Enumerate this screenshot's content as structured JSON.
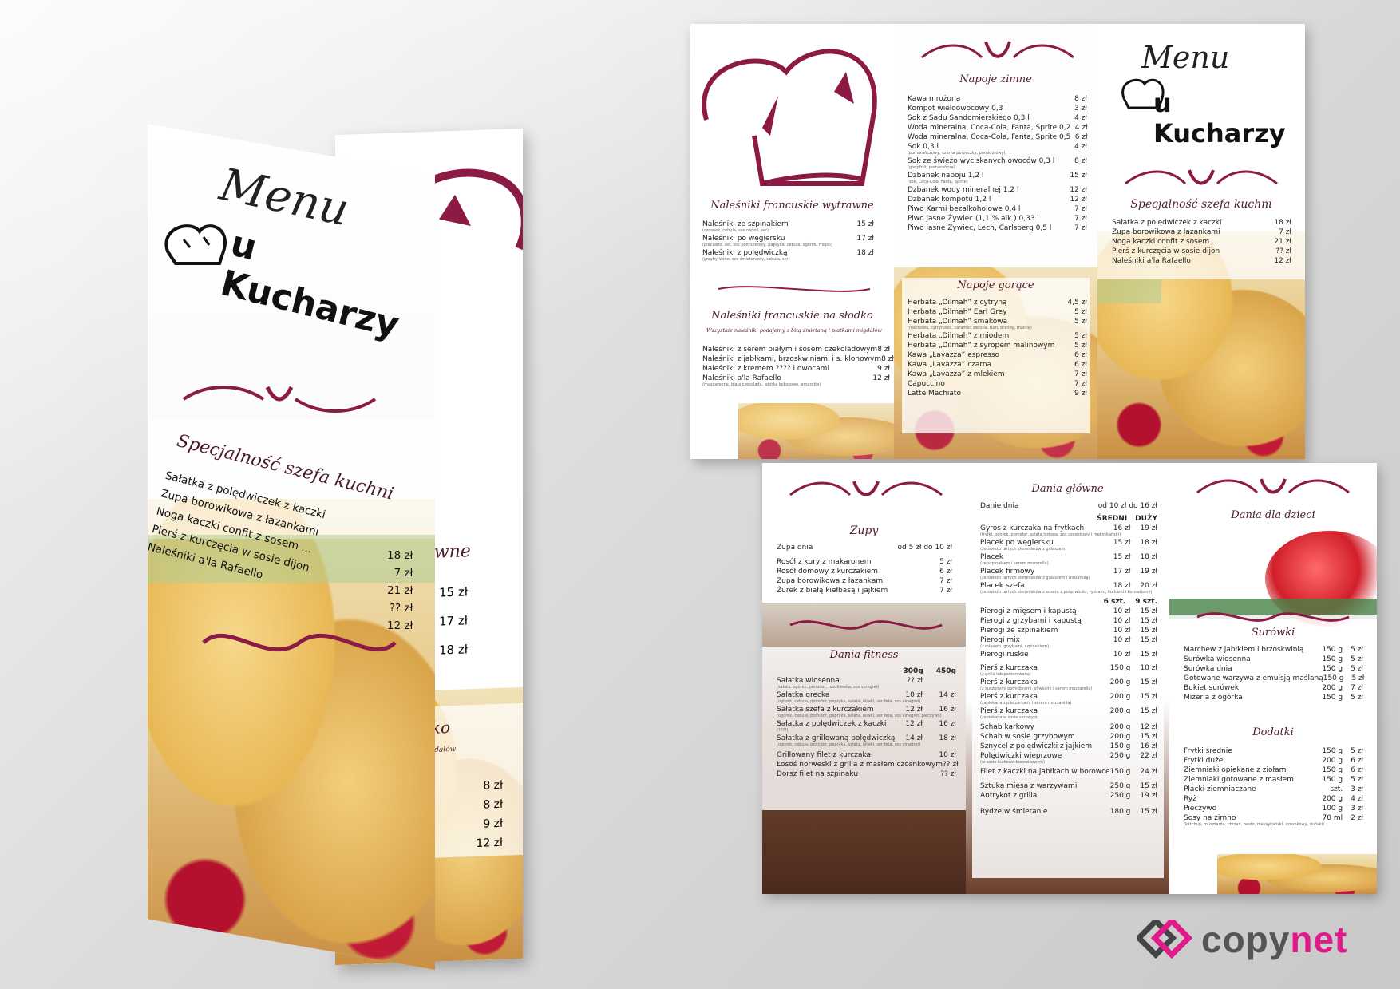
{
  "brand": {
    "menu_word": "Menu",
    "restaurant_name": "u Kucharzy",
    "maroon": "#8b1a45",
    "copynet": {
      "part1": "copy",
      "part2": "net",
      "accent": "#e01a8a"
    }
  },
  "specialties": {
    "title": "Specjalność szefa kuchni",
    "items": [
      {
        "name": "Sałatka z polędwiczek z kaczki",
        "price": "18 zł"
      },
      {
        "name": "Zupa borowikowa z łazankami",
        "price": "7 zł"
      },
      {
        "name": "Noga kaczki confit z sosem ...",
        "price": "21 zł"
      },
      {
        "name": "Pierś z kurczęcia w sosie dijon",
        "price": "?? zł"
      },
      {
        "name": "Naleśniki a'la Rafaello",
        "price": "12 zł"
      }
    ]
  },
  "savory": {
    "title": "Naleśniki francuskie wytrawne",
    "items": [
      {
        "name": "Naleśniki ze szpinakiem",
        "desc": "(czosnek, cebula, sos napoli, ser)",
        "price": "15 zł"
      },
      {
        "name": "Naleśniki po węgiersku",
        "desc": "(pieczarki, ser, sos pomidorowy, papryka, cebula, ogórek, mięso)",
        "price": "17 zł"
      },
      {
        "name": "Naleśniki z polędwiczką",
        "desc": "(grzyby leśne, sos śmietanowy, cebula, ser)",
        "price": "18 zł"
      }
    ]
  },
  "sweet": {
    "title": "Naleśniki francuskie na słodko",
    "note": "Wszystkie naleśniki podajemy z bitą śmietaną i płatkami migdałów",
    "items": [
      {
        "name": "Naleśniki z serem białym i sosem czekoladowym",
        "desc": "",
        "price": "8 zł"
      },
      {
        "name": "Naleśniki z jabłkami, brzoskwiniami i s. klonowym",
        "desc": "",
        "price": "8 zł"
      },
      {
        "name": "Naleśniki z kremem ???? i owocami",
        "desc": "",
        "price": "9 zł"
      },
      {
        "name": "Naleśniki a'la Rafaello",
        "desc": "(mascarpone, biała czekolada, wiórka kokosowe, amaretto)",
        "price": "12 zł"
      }
    ]
  },
  "cold_drinks": {
    "title": "Napoje zimne",
    "items": [
      {
        "name": "Kawa mrożona",
        "desc": "",
        "price": "8 zł"
      },
      {
        "name": "Kompot wieloowocowy 0,3 l",
        "desc": "",
        "price": "3 zł"
      },
      {
        "name": "Sok z Sadu Sandomierskiego 0,3 l",
        "desc": "",
        "price": "4 zł"
      },
      {
        "name": "Woda mineralna, Coca-Cola, Fanta, Sprite 0,2 l",
        "desc": "",
        "price": "4 zł"
      },
      {
        "name": "Woda mineralna, Coca-Cola, Fanta, Sprite 0,5 l",
        "desc": "",
        "price": "6 zł"
      },
      {
        "name": "Sok 0,3 l",
        "desc": "(pomarańczowy, czarna porzeczka, pomidorowy)",
        "price": "4 zł"
      },
      {
        "name": "Sok ze świeżo wyciskanych owoców 0,3 l",
        "desc": "(grejpfrut, pomarańcza)",
        "price": "8 zł"
      },
      {
        "name": "Dzbanek napoju 1,2 l",
        "desc": "(sok, Coca-Cola, Fanta, Sprite)",
        "price": "15 zł"
      },
      {
        "name": "Dzbanek wody mineralnej 1,2 l",
        "desc": "",
        "price": "12 zł"
      },
      {
        "name": "Dzbanek kompotu 1,2 l",
        "desc": "",
        "price": "12 zł"
      },
      {
        "name": "Piwo Karmi bezalkoholowe 0,4 l",
        "desc": "",
        "price": "7 zł"
      },
      {
        "name": "Piwo jasne Żywiec (1,1 % alk.) 0,33 l",
        "desc": "",
        "price": "7 zł"
      },
      {
        "name": "Piwo jasne Żywiec, Lech, Carlsberg 0,5 l",
        "desc": "",
        "price": "7 zł"
      }
    ]
  },
  "hot_drinks": {
    "title": "Napoje gorące",
    "items": [
      {
        "name": "Herbata „Dilmah” z cytryną",
        "desc": "",
        "price": "4,5 zł"
      },
      {
        "name": "Herbata „Dilmah” Earl Grey",
        "desc": "",
        "price": "5 zł"
      },
      {
        "name": "Herbata „Dilmah” smakowa",
        "desc": "(malinowa, cytrynowa, caramel, zielona, rum, brandy, malina)",
        "price": "5 zł"
      },
      {
        "name": "Herbata „Dilmah” z miodem",
        "desc": "",
        "price": "5 zł"
      },
      {
        "name": "Herbata „Dilmah” z syropem malinowym",
        "desc": "",
        "price": "5 zł"
      },
      {
        "name": "Kawa „Lavazza” espresso",
        "desc": "",
        "price": "6 zł"
      },
      {
        "name": "Kawa „Lavazza” czarna",
        "desc": "",
        "price": "6 zł"
      },
      {
        "name": "Kawa „Lavazza” z mlekiem",
        "desc": "",
        "price": "7 zł"
      },
      {
        "name": "Capuccino",
        "desc": "",
        "price": "7 zł"
      },
      {
        "name": "Latte Machiato",
        "desc": "",
        "price": "9 zł"
      }
    ]
  },
  "soups": {
    "title": "Zupy",
    "daily": {
      "name": "Zupa dnia",
      "price": "od 5 zł do 10 zł"
    },
    "items": [
      {
        "name": "Rosół z kury z makaronem",
        "price": "5 zł"
      },
      {
        "name": "Rosół domowy z kurczakiem",
        "price": "6 zł"
      },
      {
        "name": "Zupa borowikowa z łazankami",
        "price": "7 zł"
      },
      {
        "name": "Żurek z białą kiełbasą i jajkiem",
        "price": "7 zł"
      }
    ]
  },
  "fitness": {
    "title": "Dania fitness",
    "col1": "300g",
    "col2": "450g",
    "items": [
      {
        "name": "Sałatka wiosenna",
        "desc": "(sałata, ogórek, pomidor, rzodkiewka, sos vinegret)",
        "p1": "?? zł",
        "p2": ""
      },
      {
        "name": "Sałatka grecka",
        "desc": "(ogórek, cebula, pomidor, papryka, sałata, oliwki, ser feta, sos vinegret)",
        "p1": "10 zł",
        "p2": "14 zł"
      },
      {
        "name": "Sałatka szefa z kurczakiem",
        "desc": "(ogórek, cebula, pomidor, papryka, sałata, oliwki, ser feta, sos vinegret, pieczywo)",
        "p1": "12 zł",
        "p2": "16 zł"
      },
      {
        "name": "Sałatka z polędwiczek z kaczki",
        "desc": "(????)",
        "p1": "12 zł",
        "p2": "16 zł"
      },
      {
        "name": "Sałatka z grillowaną polędwiczką",
        "desc": "(ogórek, cebula, pomidor, papryka, sałata, oliwki, ser feta, sos vinegret)",
        "p1": "14 zł",
        "p2": "18 zł"
      },
      {
        "name": "Grillowany filet z kurczaka",
        "desc": "",
        "p1": "",
        "p2": "10 zł"
      },
      {
        "name": "Łosoś norweski z grilla z masłem czosnkowym",
        "desc": "",
        "p1": "",
        "p2": "?? zł"
      },
      {
        "name": "Dorsz filet na szpinaku",
        "desc": "",
        "p1": "",
        "p2": "?? zł"
      }
    ]
  },
  "mains": {
    "title": "Dania główne",
    "daily": {
      "name": "Danie dnia",
      "price": "od 10 zł do 16 zł"
    },
    "col1": "ŚREDNI",
    "col2": "DUŻY",
    "items": [
      {
        "name": "Gyros z kurczaka na frytkach",
        "desc": "(frytki, ogórek, pomidor, sałata lodowa, sos czosnkowy i meksykański)",
        "p1": "16 zł",
        "p2": "19 zł"
      },
      {
        "name": "Placek po węgiersku",
        "desc": "(ze świeżo tartych ziemniaków z gulaszem)",
        "p1": "15 zł",
        "p2": "18 zł"
      },
      {
        "name": "Placek",
        "desc": "(ze szpinakiem i serem mozarella)",
        "p1": "15 zł",
        "p2": "18 zł"
      },
      {
        "name": "Placek firmowy",
        "desc": "(ze świeżo tartych ziemniaków z gulaszem i mozarellą)",
        "p1": "17 zł",
        "p2": "19 zł"
      },
      {
        "name": "Placek szefa",
        "desc": "(ze świeżo tartych ziemniaków z sosem z polędwiczki, rydzami, kurkami i borowikami)",
        "p1": "18 zł",
        "p2": "20 zł"
      }
    ],
    "col3": "6 szt.",
    "col4": "9 szt.",
    "pierogi": [
      {
        "name": "Pierogi z mięsem i kapustą",
        "desc": "",
        "p1": "10 zł",
        "p2": "15 zł"
      },
      {
        "name": "Pierogi z grzybami i kapustą",
        "desc": "",
        "p1": "10 zł",
        "p2": "15 zł"
      },
      {
        "name": "Pierogi ze szpinakiem",
        "desc": "",
        "p1": "10 zł",
        "p2": "15 zł"
      },
      {
        "name": "Pierogi mix",
        "desc": "(z mięsem, grzybami, szpinakiem)",
        "p1": "10 zł",
        "p2": "15 zł"
      },
      {
        "name": "Pierogi ruskie",
        "desc": "",
        "p1": "10 zł",
        "p2": "15 zł"
      }
    ],
    "meats": [
      {
        "name": "Pierś z kurczaka",
        "desc": "(z grilla lub panierowana)",
        "p1": "150 g",
        "p2": "10 zł"
      },
      {
        "name": "Pierś z kurczaka",
        "desc": "(z suszonymi pomidorami, oliwkami i serem mozzarella)",
        "p1": "200 g",
        "p2": "15 zł"
      },
      {
        "name": "Pierś z kurczaka",
        "desc": "(zapiekana z pieczarkami i serem mozzarella)",
        "p1": "200 g",
        "p2": "15 zł"
      },
      {
        "name": "Pierś z kurczaka",
        "desc": "(zapiekana w sosie serowym)",
        "p1": "200 g",
        "p2": "15 zł"
      },
      {
        "name": "Schab karkowy",
        "desc": "",
        "p1": "200 g",
        "p2": "12 zł"
      },
      {
        "name": "Schab w sosie grzybowym",
        "desc": "",
        "p1": "200 g",
        "p2": "15 zł"
      },
      {
        "name": "Sznycel z polędwiczki z jajkiem",
        "desc": "",
        "p1": "150 g",
        "p2": "16 zł"
      },
      {
        "name": "Polędwiczki wieprzowe",
        "desc": "(w sosie kurkowo-borowikowym)",
        "p1": "250 g",
        "p2": "22 zł"
      },
      {
        "name": "Filet z kaczki na jabłkach w borówce",
        "desc": "",
        "p1": "150 g",
        "p2": "24 zł"
      },
      {
        "name": "Sztuka mięsa z warzywami",
        "desc": "",
        "p1": "250 g",
        "p2": "15 zł"
      },
      {
        "name": "Antrykot z grilla",
        "desc": "",
        "p1": "250 g",
        "p2": "19 zł"
      },
      {
        "name": "Rydze w śmietanie",
        "desc": "",
        "p1": "180 g",
        "p2": "15 zł"
      }
    ]
  },
  "kids": {
    "title": "Dania dla dzieci"
  },
  "salads": {
    "title": "Surówki",
    "items": [
      {
        "name": "Marchew z jabłkiem i brzoskwinią",
        "p1": "150 g",
        "p2": "5 zł"
      },
      {
        "name": "Surówka wiosenna",
        "p1": "150 g",
        "p2": "5 zł"
      },
      {
        "name": "Surówka dnia",
        "p1": "150 g",
        "p2": "5 zł"
      },
      {
        "name": "Gotowane warzywa z emulsją maślaną",
        "p1": "150 g",
        "p2": "5 zł"
      },
      {
        "name": "Bukiet surówek",
        "p1": "200 g",
        "p2": "7 zł"
      },
      {
        "name": "Mizeria z ogórka",
        "p1": "150 g",
        "p2": "5 zł"
      }
    ]
  },
  "extras": {
    "title": "Dodatki",
    "items": [
      {
        "name": "Frytki średnie",
        "desc": "",
        "p1": "150 g",
        "p2": "5 zł"
      },
      {
        "name": "Frytki duże",
        "desc": "",
        "p1": "200 g",
        "p2": "6 zł"
      },
      {
        "name": "Ziemniaki opiekane z ziołami",
        "desc": "",
        "p1": "150 g",
        "p2": "6 zł"
      },
      {
        "name": "Ziemniaki gotowane z masłem",
        "desc": "",
        "p1": "150 g",
        "p2": "5 zł"
      },
      {
        "name": "Placki ziemniaczane",
        "desc": "",
        "p1": "szt.",
        "p2": "3 zł"
      },
      {
        "name": "Ryż",
        "desc": "",
        "p1": "200 g",
        "p2": "4 zł"
      },
      {
        "name": "Pieczywo",
        "desc": "",
        "p1": "100 g",
        "p2": "3 zł"
      },
      {
        "name": "Sosy na zimno",
        "desc": "(ketchup, musztarda, chrzan, pesto, meksykański, czosnkowy, duński)",
        "p1": "70 ml",
        "p2": "2 zł"
      }
    ]
  },
  "icons": [
    "chef-hat-icon",
    "ornament-swirl-icon",
    "copynet-logo-icon"
  ]
}
